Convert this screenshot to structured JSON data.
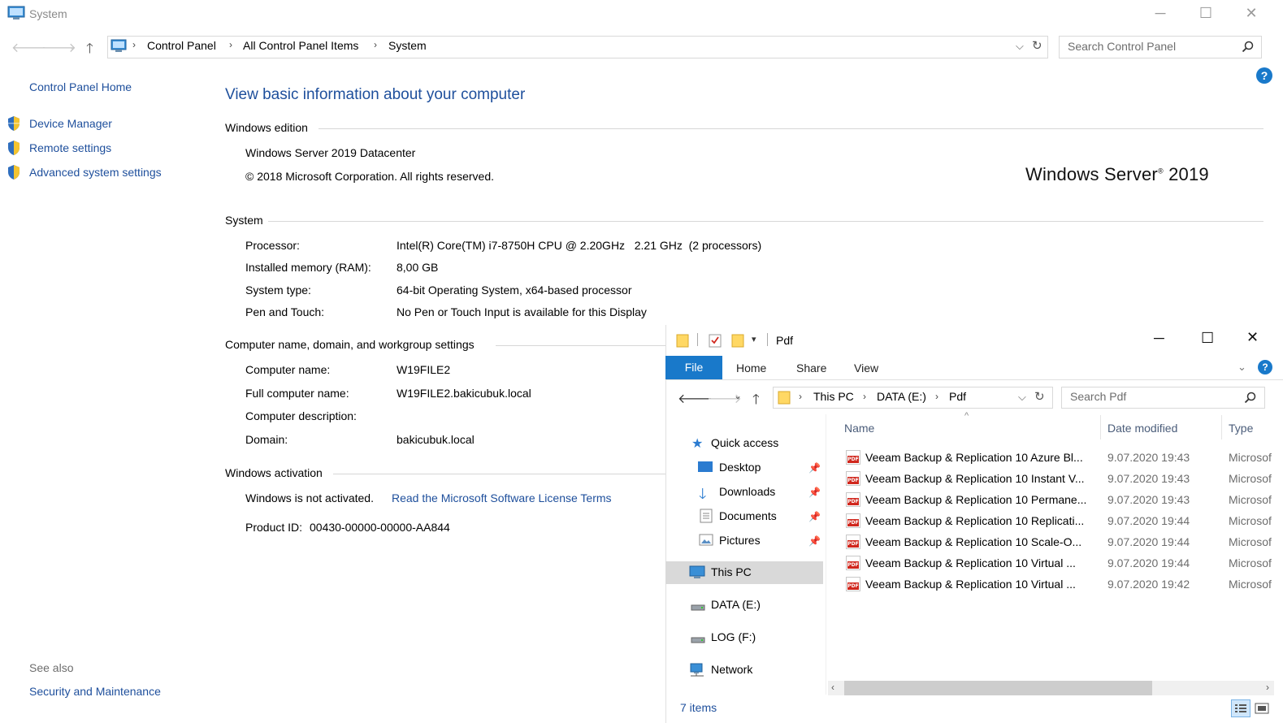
{
  "window": {
    "title": "System",
    "controls": {
      "minimize": "─",
      "maximize": "☐",
      "close": "✕"
    }
  },
  "address_bar": {
    "breadcrumbs": [
      "Control Panel",
      "All Control Panel Items",
      "System"
    ],
    "search_placeholder": "Search Control Panel"
  },
  "sidebar": {
    "home": "Control Panel Home",
    "items": [
      {
        "label": "Device Manager",
        "icon": "shield-icon"
      },
      {
        "label": "Remote settings",
        "icon": "shield-icon"
      },
      {
        "label": "Advanced system settings",
        "icon": "shield-icon"
      }
    ],
    "see_also_label": "See also",
    "see_also_items": [
      "Security and Maintenance"
    ]
  },
  "main": {
    "title": "View basic information about your computer",
    "edition": {
      "heading": "Windows edition",
      "name": "Windows Server 2019 Datacenter",
      "copyright": "© 2018 Microsoft Corporation. All rights reserved.",
      "logo_text": "Windows Server",
      "logo_year": "2019"
    },
    "system": {
      "heading": "System",
      "rows": [
        {
          "label": "Processor:",
          "value": "Intel(R) Core(TM) i7-8750H CPU @ 2.20GHz   2.21 GHz  (2 processors)"
        },
        {
          "label": "Installed memory (RAM):",
          "value": "8,00 GB"
        },
        {
          "label": "System type:",
          "value": "64-bit Operating System, x64-based processor"
        },
        {
          "label": "Pen and Touch:",
          "value": "No Pen or Touch Input is available for this Display"
        }
      ]
    },
    "computer": {
      "heading": "Computer name, domain, and workgroup settings",
      "rows": [
        {
          "label": "Computer name:",
          "value": "W19FILE2"
        },
        {
          "label": "Full computer name:",
          "value": "W19FILE2.bakicubuk.local"
        },
        {
          "label": "Computer description:",
          "value": ""
        },
        {
          "label": "Domain:",
          "value": "bakicubuk.local"
        }
      ]
    },
    "activation": {
      "heading": "Windows activation",
      "status": "Windows is not activated.",
      "license_link": "Read the Microsoft Software License Terms",
      "product_id_label": "Product ID:",
      "product_id": "00430-00000-00000-AA844"
    }
  },
  "explorer": {
    "title": "Pdf",
    "ribbon_tabs": [
      "File",
      "Home",
      "Share",
      "View"
    ],
    "breadcrumbs": [
      "This PC",
      "DATA (E:)",
      "Pdf"
    ],
    "search_placeholder": "Search Pdf",
    "nav": {
      "quick_access": "Quick access",
      "quick_items": [
        "Desktop",
        "Downloads",
        "Documents",
        "Pictures"
      ],
      "this_pc": "This PC",
      "drives": [
        "DATA (E:)",
        "LOG (F:)"
      ],
      "network": "Network"
    },
    "columns": {
      "name": "Name",
      "date": "Date modified",
      "type": "Type"
    },
    "files": [
      {
        "name": "Veeam Backup & Replication 10 Azure Bl...",
        "date": "9.07.2020 19:43",
        "type": "Microsof"
      },
      {
        "name": "Veeam Backup & Replication 10 Instant V...",
        "date": "9.07.2020 19:43",
        "type": "Microsof"
      },
      {
        "name": "Veeam Backup & Replication 10 Permane...",
        "date": "9.07.2020 19:43",
        "type": "Microsof"
      },
      {
        "name": "Veeam Backup & Replication 10 Replicati...",
        "date": "9.07.2020 19:44",
        "type": "Microsof"
      },
      {
        "name": "Veeam Backup & Replication 10 Scale-O...",
        "date": "9.07.2020 19:44",
        "type": "Microsof"
      },
      {
        "name": "Veeam Backup & Replication 10 Virtual ...",
        "date": "9.07.2020 19:44",
        "type": "Microsof"
      },
      {
        "name": "Veeam Backup & Replication 10 Virtual ...",
        "date": "9.07.2020 19:42",
        "type": "Microsof"
      }
    ],
    "status": "7 items"
  },
  "colors": {
    "link": "#1e4f9c",
    "accent": "#1979ca",
    "pdf": "#d0271d"
  }
}
